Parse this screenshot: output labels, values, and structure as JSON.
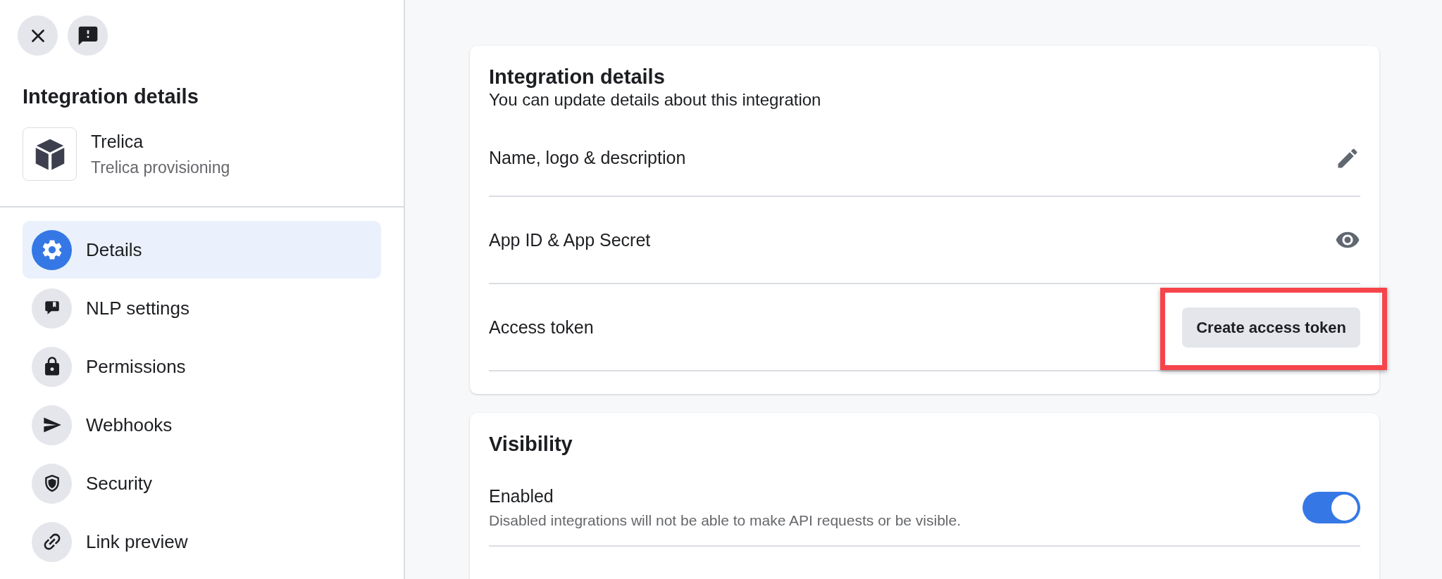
{
  "sidebar": {
    "title": "Integration details",
    "app": {
      "name": "Trelica",
      "subtitle": "Trelica provisioning"
    },
    "nav": [
      {
        "label": "Details",
        "selected": true
      },
      {
        "label": "NLP settings",
        "selected": false
      },
      {
        "label": "Permissions",
        "selected": false
      },
      {
        "label": "Webhooks",
        "selected": false
      },
      {
        "label": "Security",
        "selected": false
      },
      {
        "label": "Link preview",
        "selected": false
      }
    ]
  },
  "details_card": {
    "title": "Integration details",
    "subtitle": "You can update details about this integration",
    "rows": [
      {
        "kind": "edit",
        "label": "Name, logo & description",
        "highlighted": false
      },
      {
        "kind": "reveal",
        "label": "App ID & App Secret",
        "highlighted": false
      },
      {
        "kind": "action",
        "label": "Access token",
        "button": "Create access token",
        "highlighted": true
      }
    ]
  },
  "visibility_card": {
    "title": "Visibility",
    "setting": {
      "label": "Enabled",
      "description": "Disabled integrations will not be able to make API requests or be visible.",
      "on": true
    }
  }
}
